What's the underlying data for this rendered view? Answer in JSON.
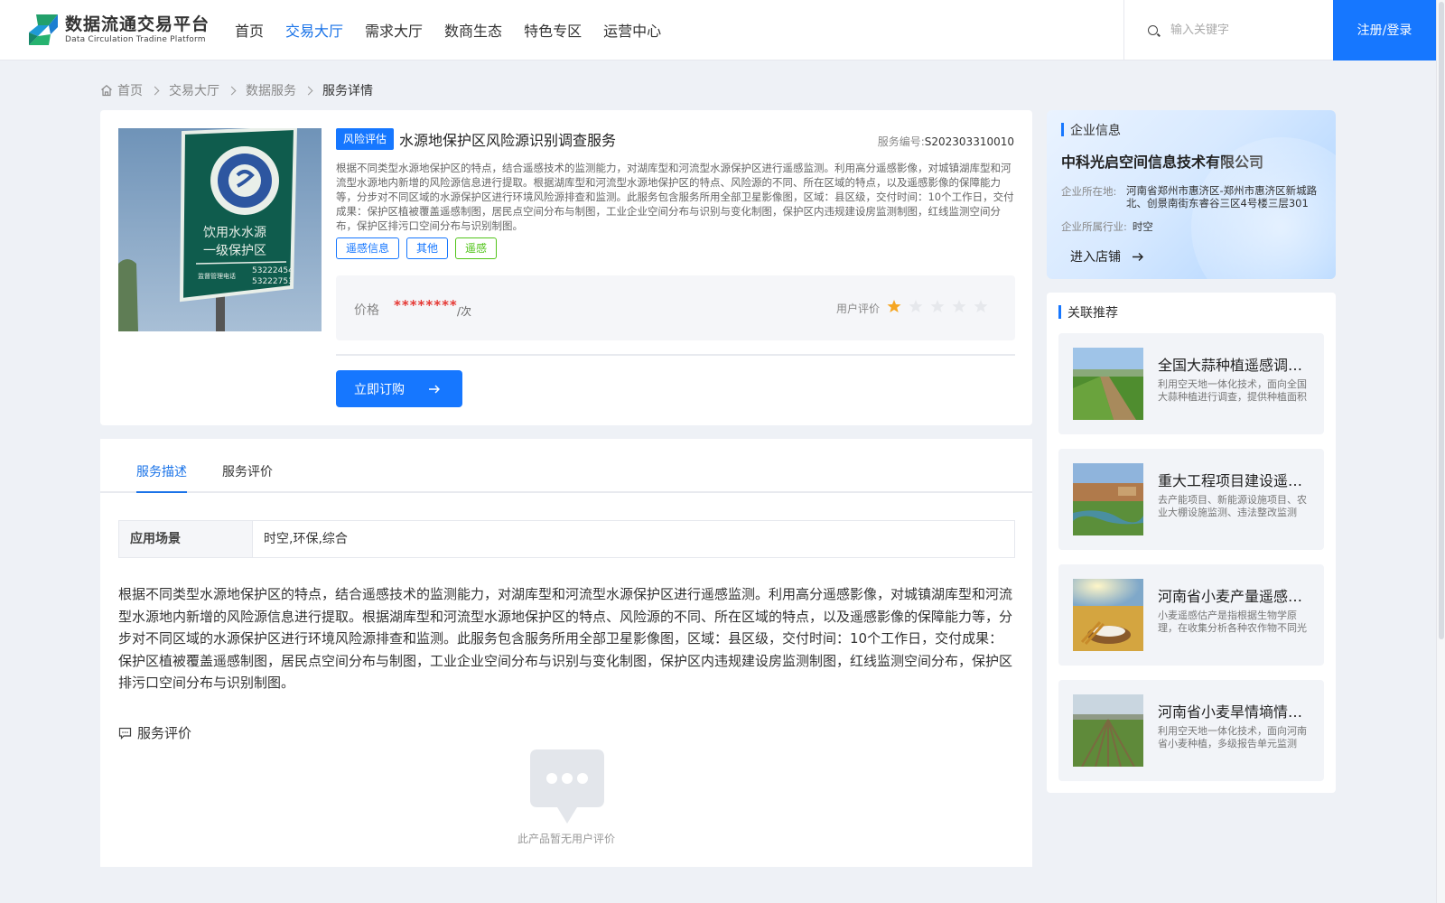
{
  "header": {
    "logo_cn": "数据流通交易平台",
    "logo_en": "Data Circulation Tradine Platform",
    "nav": [
      "首页",
      "交易大厅",
      "需求大厅",
      "数商生态",
      "特色专区",
      "运营中心"
    ],
    "active_nav": 1,
    "search_placeholder": "输入关键字",
    "login_label": "注册/登录",
    "brand_color": "#1677ff"
  },
  "breadcrumb": [
    "首页",
    "交易大厅",
    "数据服务",
    "服务详情"
  ],
  "product": {
    "category_badge": "风险评估",
    "title": "水源地保护区风险源识别调查服务",
    "service_no_label": "服务编号:",
    "service_no": "S202303310010",
    "description": "根据不同类型水源地保护区的特点，结合遥感技术的监测能力，对湖库型和河流型水源保护区进行遥感监测。利用高分遥感影像，对城镇湖库型和河流型水源地内新增的风险源信息进行提取。根据湖库型和河流型水源地保护区的特点、风险源的不同、所在区域的特点，以及遥感影像的保障能力等，分步对不同区域的水源保护区进行环境风险源排查和监测。此服务包含服务所用全部卫星影像图，区域：县区级，交付时间：10个工作日，交付成果：保护区植被覆盖遥感制图，居民点空间分布与制图，工业企业空间分布与识别与变化制图，保护区内违规建设房监测制图，红线监测空间分布，保护区排污口空间分布与识别制图。",
    "tags": [
      "遥感信息",
      "其他",
      "遥感"
    ],
    "price_label": "价格",
    "price": "********",
    "price_unit": "/次",
    "rating_label": "用户评价",
    "rating": 1,
    "rating_max": 5,
    "buy_label": "立即订购",
    "sign_lines": [
      "饮用水水源",
      "一级保护区",
      "监督管理电话",
      "53222454",
      "53222753"
    ]
  },
  "tabs": [
    "服务描述",
    "服务评价"
  ],
  "details": {
    "scene_key": "应用场景",
    "scene_value": "时空,环保,综合",
    "long_description": "根据不同类型水源地保护区的特点，结合遥感技术的监测能力，对湖库型和河流型水源保护区进行遥感监测。利用高分遥感影像，对城镇湖库型和河流型水源地内新增的风险源信息进行提取。根据湖库型和河流型水源地保护区的特点、风险源的不同、所在区域的特点，以及遥感影像的保障能力等，分步对不同区域的水源保护区进行环境风险源排查和监测。此服务包含服务所用全部卫星影像图，区域：县区级，交付时间：10个工作日，交付成果：保护区植被覆盖遥感制图，居民点空间分布与制图，工业企业空间分布与识别与变化制图，保护区内违规建设房监测制图，红线监测空间分布，保护区排污口空间分布与识别制图。",
    "review_heading": "服务评价",
    "empty_review": "此产品暂无用户评价"
  },
  "company": {
    "section_title": "企业信息",
    "name": "中科光启空间信息技术有限公司",
    "address_label": "企业所在地:",
    "address": "河南省郑州市惠济区-郑州市惠济区新城路北、创景南街东睿谷三区4号楼三层301",
    "industry_label": "企业所属行业:",
    "industry": "时空",
    "shop_link": "进入店铺"
  },
  "recommend": {
    "section_title": "关联推荐",
    "items": [
      {
        "title": "全国大蒜种植遥感调查服务",
        "desc": "利用空天地一体化技术，面向全国大蒜种植进行调查，提供种植面积与分布信息"
      },
      {
        "title": "重大工程项目建设遥感监测服务",
        "desc": "去产能项目、新能源设施项目、农业大棚设施监测、违法整改监测"
      },
      {
        "title": "河南省小麦产量遥感估算服务",
        "desc": "小麦遥感估产是指根据生物学原理，在收集分析各种农作物不同光谱特征"
      },
      {
        "title": "河南省小麦旱情墒情监测服务",
        "desc": "利用空天地一体化技术，面向河南省小麦种植，多级报告单元监测"
      }
    ]
  }
}
